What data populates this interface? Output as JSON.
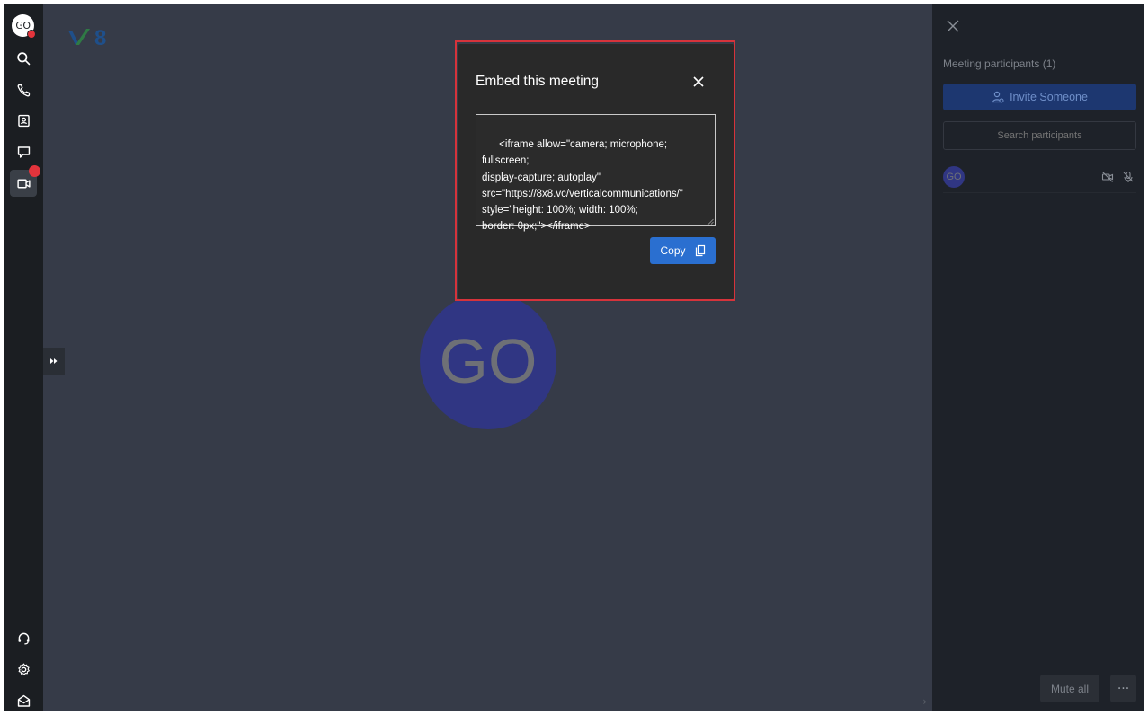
{
  "user": {
    "initials": "GO"
  },
  "rail": {
    "icons": [
      "search-icon",
      "phone-icon",
      "contacts-icon",
      "chat-icon",
      "video-icon",
      "headset-icon",
      "gear-icon",
      "inbox-icon"
    ]
  },
  "stage": {
    "logo_text": "8",
    "avatar_initials": "GO",
    "background": "#363b48"
  },
  "modal": {
    "title": "Embed this meeting",
    "code": "<iframe allow=\"camera; microphone; fullscreen;\ndisplay-capture; autoplay\"\nsrc=\"https://8x8.vc/verticalcommunications/\"\nstyle=\"height: 100%; width: 100%;\nborder: 0px;\"></iframe>",
    "copy_label": "Copy",
    "highlight_color": "#d6333b"
  },
  "panel": {
    "title": "Meeting participants (1)",
    "invite_label": "Invite Someone",
    "search_placeholder": "Search participants",
    "participants": [
      {
        "initials": "GO"
      }
    ],
    "mute_all_label": "Mute all",
    "more_label": "···"
  },
  "colors": {
    "accent": "#2a6fd0",
    "alert": "#e3343c",
    "avatar": "#303683"
  }
}
